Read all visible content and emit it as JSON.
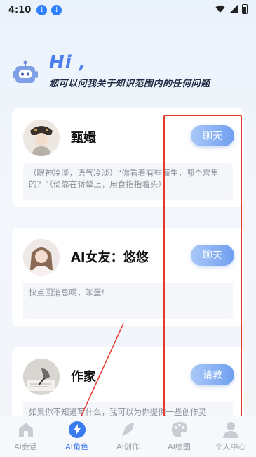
{
  "status_bar": {
    "time": "4:10"
  },
  "header": {
    "greeting": "Hi ,",
    "subtitle": "您可以问我关于知识范围内的任何问题"
  },
  "cards": [
    {
      "name": "甄嬛",
      "button": "聊天",
      "description": "（眼神冷淡，语气冷淡）“你看着有些面生，哪个宫里的？”（倚靠在轿辇上，用食指指着头）"
    },
    {
      "name": "AI女友：悠悠",
      "button": "聊天",
      "description": "快点回消息啊，笨蛋!"
    },
    {
      "name": "作家",
      "button": "请教",
      "description": "如果你不知道写什么，我可以为你提供一些创作灵"
    }
  ],
  "tabbar": {
    "items": [
      {
        "label": "AI会话",
        "icon": "home-icon",
        "active": false
      },
      {
        "label": "AI角色",
        "icon": "lightning-icon",
        "active": true
      },
      {
        "label": "AI创作",
        "icon": "feather-icon",
        "active": false
      },
      {
        "label": "AI绘图",
        "icon": "palette-icon",
        "active": false
      },
      {
        "label": "个人中心",
        "icon": "person-icon",
        "active": false
      }
    ]
  },
  "colors": {
    "accent": "#4e7df0",
    "active_tab": "#3b7bf0",
    "inactive_tab": "#9aa0aa",
    "annotation_red": "#e5382b"
  }
}
